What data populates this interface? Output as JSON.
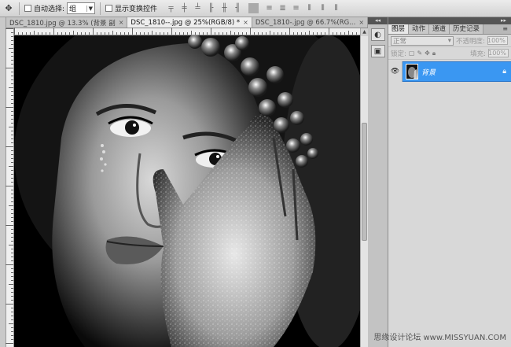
{
  "options_bar": {
    "tool_icon": "move-tool-icon",
    "auto_select_label": "自动选择:",
    "auto_select_checked": false,
    "auto_select_value": "组",
    "show_transform_label": "显示变换控件",
    "show_transform_checked": false
  },
  "tabs": [
    {
      "label": "DSC_1810.jpg @ 13.3% (背景 副",
      "active": false
    },
    {
      "label": "DSC_1810--.jpg @ 25%(RGB/8) *",
      "active": true
    },
    {
      "label": "DSC_1810-.jpg @ 66.7%(RG...",
      "active": false
    }
  ],
  "layers_panel": {
    "tabs": [
      "图层",
      "动作",
      "通道",
      "历史记录"
    ],
    "active_tab": "图层",
    "blend_mode": "正常",
    "opacity_label": "不透明度:",
    "opacity_value": "100%",
    "lock_label": "锁定:",
    "fill_label": "填充:",
    "fill_value": "100%",
    "layers": [
      {
        "name": "背景",
        "visible": true,
        "locked": true,
        "selected": true
      }
    ]
  },
  "watermark": "思缘设计论坛 www.MISSYUAN.COM",
  "colors": {
    "selection": "#3a97f2",
    "canvas_bg": "#000000",
    "chrome": "#d6d6d6"
  }
}
